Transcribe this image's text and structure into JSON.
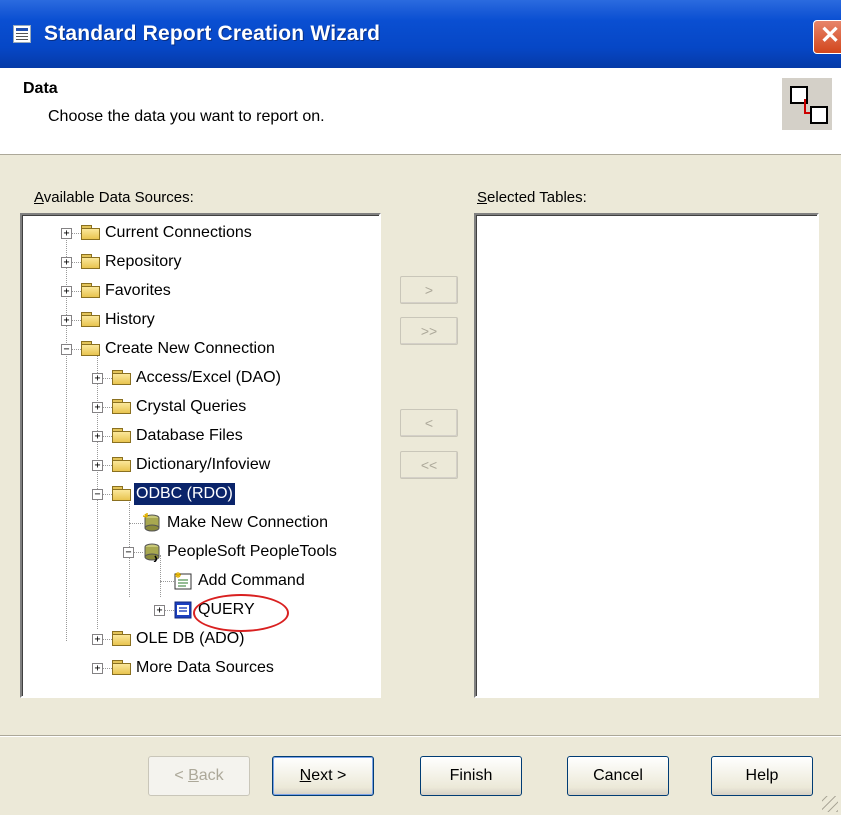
{
  "window": {
    "title": "Standard Report Creation Wizard",
    "close_glyph": "✕"
  },
  "header": {
    "title": "Data",
    "subtitle": "Choose the data you want to report on."
  },
  "available": {
    "label_access": "A",
    "label_rest": "vailable Data Sources:",
    "tree": [
      {
        "label": "Current Connections",
        "expander": "+",
        "icon": "folder-icon"
      },
      {
        "label": "Repository",
        "expander": "+",
        "icon": "folder-icon"
      },
      {
        "label": "Favorites",
        "expander": "+",
        "icon": "folder-icon"
      },
      {
        "label": "History",
        "expander": "+",
        "icon": "folder-icon"
      },
      {
        "label": "Create New Connection",
        "expander": "−",
        "icon": "folder-icon"
      },
      {
        "label": "Access/Excel (DAO)",
        "expander": "+",
        "icon": "folder-icon"
      },
      {
        "label": "Crystal Queries",
        "expander": "+",
        "icon": "folder-icon"
      },
      {
        "label": "Database Files",
        "expander": "+",
        "icon": "folder-icon"
      },
      {
        "label": "Dictionary/Infoview",
        "expander": "+",
        "icon": "folder-icon"
      },
      {
        "label": "ODBC (RDO)",
        "expander": "−",
        "icon": "folder-icon",
        "selected": true
      },
      {
        "label": "Make New Connection",
        "icon": "new-connection-icon"
      },
      {
        "label": "PeopleSoft PeopleTools",
        "expander": "−",
        "icon": "database-icon"
      },
      {
        "label": "Add Command",
        "icon": "add-command-icon"
      },
      {
        "label": "QUERY",
        "expander": "+",
        "icon": "query-icon",
        "annotated": true
      },
      {
        "label": "OLE DB (ADO)",
        "expander": "+",
        "icon": "folder-icon"
      },
      {
        "label": "More Data Sources",
        "expander": "+",
        "icon": "folder-icon"
      }
    ]
  },
  "selected": {
    "label_access": "S",
    "label_rest": "elected Tables:"
  },
  "transfer": {
    "add": ">",
    "add_all": ">>",
    "remove": "<",
    "remove_all": "<<"
  },
  "footer": {
    "back_prefix": "< ",
    "back_access": "B",
    "back_rest": "ack",
    "next_access": "N",
    "next_rest": "ext >",
    "finish": "Finish",
    "cancel": "Cancel",
    "help": "Help"
  },
  "colors": {
    "titlebar": "#0a4fd2",
    "selection": "#0a246a",
    "annotation": "#d92020"
  }
}
